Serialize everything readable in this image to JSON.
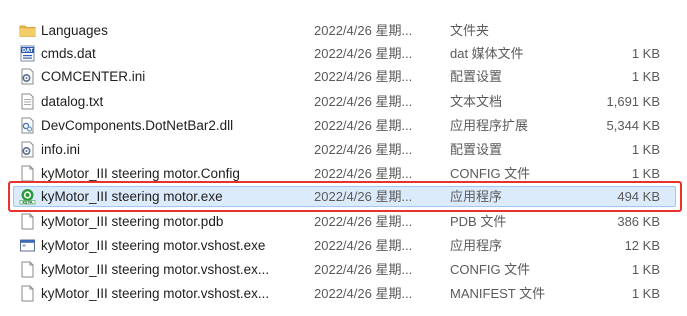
{
  "files": [
    {
      "icon": "folder-icon",
      "name": "Languages",
      "date": "2022/4/26 星期...",
      "type": "文件夹",
      "size": ""
    },
    {
      "icon": "dat-file-icon",
      "name": "cmds.dat",
      "date": "2022/4/26 星期...",
      "type": "dat 媒体文件",
      "size": "1 KB"
    },
    {
      "icon": "ini-file-icon",
      "name": "COMCENTER.ini",
      "date": "2022/4/26 星期...",
      "type": "配置设置",
      "size": "1 KB"
    },
    {
      "icon": "txt-file-icon",
      "name": "datalog.txt",
      "date": "2022/4/26 星期...",
      "type": "文本文档",
      "size": "1,691 KB"
    },
    {
      "icon": "dll-file-icon",
      "name": "DevComponents.DotNetBar2.dll",
      "date": "2022/4/26 星期...",
      "type": "应用程序扩展",
      "size": "5,344 KB"
    },
    {
      "icon": "ini-file-icon",
      "name": "info.ini",
      "date": "2022/4/26 星期...",
      "type": "配置设置",
      "size": "1 KB"
    },
    {
      "icon": "config-file-icon",
      "name": "kyMotor_III steering motor.Config",
      "date": "2022/4/26 星期...",
      "type": "CONFIG 文件",
      "size": "1 KB"
    },
    {
      "icon": "exe-app-icon",
      "name": "kyMotor_III steering motor.exe",
      "date": "2022/4/26 星期...",
      "type": "应用程序",
      "size": "494 KB"
    },
    {
      "icon": "pdb-file-icon",
      "name": "kyMotor_III steering motor.pdb",
      "date": "2022/4/26 星期...",
      "type": "PDB 文件",
      "size": "386 KB"
    },
    {
      "icon": "exe-window-icon",
      "name": "kyMotor_III steering motor.vshost.exe",
      "date": "2022/4/26 星期...",
      "type": "应用程序",
      "size": "12 KB"
    },
    {
      "icon": "config-file-icon",
      "name": "kyMotor_III steering motor.vshost.ex...",
      "date": "2022/4/26 星期...",
      "type": "CONFIG 文件",
      "size": "1 KB"
    },
    {
      "icon": "manifest-file-icon",
      "name": "kyMotor_III steering motor.vshost.ex...",
      "date": "2022/4/26 星期...",
      "type": "MANIFEST 文件",
      "size": "1 KB"
    }
  ],
  "selected_index": 7,
  "colors": {
    "highlight": "#e8322b",
    "selection": "#dcebfc",
    "folder": "#e8b84a"
  }
}
